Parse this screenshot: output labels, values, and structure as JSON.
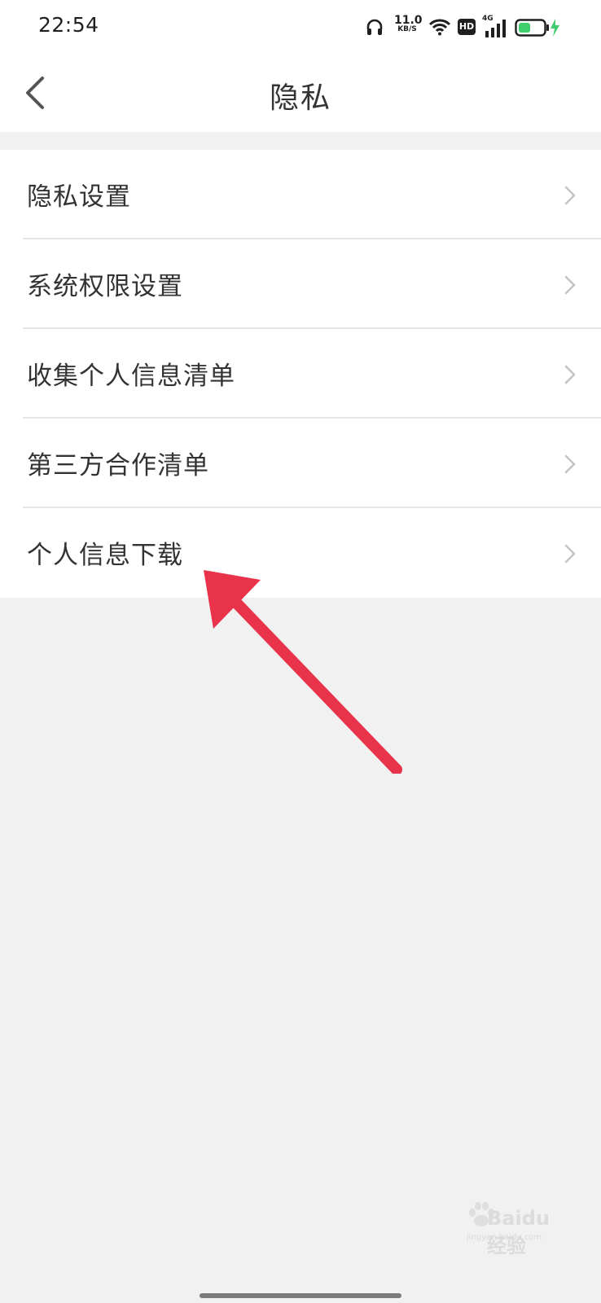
{
  "status_bar": {
    "time": "22:54",
    "net_speed_value": "11.0",
    "net_speed_unit": "KB/S",
    "hd_badge": "HD",
    "network_type": "4G",
    "icons": [
      "headphones-icon",
      "wifi-icon",
      "signal-icon",
      "battery-charging-icon"
    ],
    "battery_color": "#3ecf6c"
  },
  "header": {
    "title": "隐私",
    "back_icon": "chevron-left-icon"
  },
  "menu": {
    "items": [
      {
        "label": "隐私设置"
      },
      {
        "label": "系统权限设置"
      },
      {
        "label": "收集个人信息清单"
      },
      {
        "label": "第三方合作清单"
      },
      {
        "label": "个人信息下载"
      }
    ]
  },
  "annotation": {
    "arrow_color": "#e8334a"
  },
  "watermark": {
    "text": "Baidu经验",
    "subtext": "jingyan.baidu.com"
  }
}
